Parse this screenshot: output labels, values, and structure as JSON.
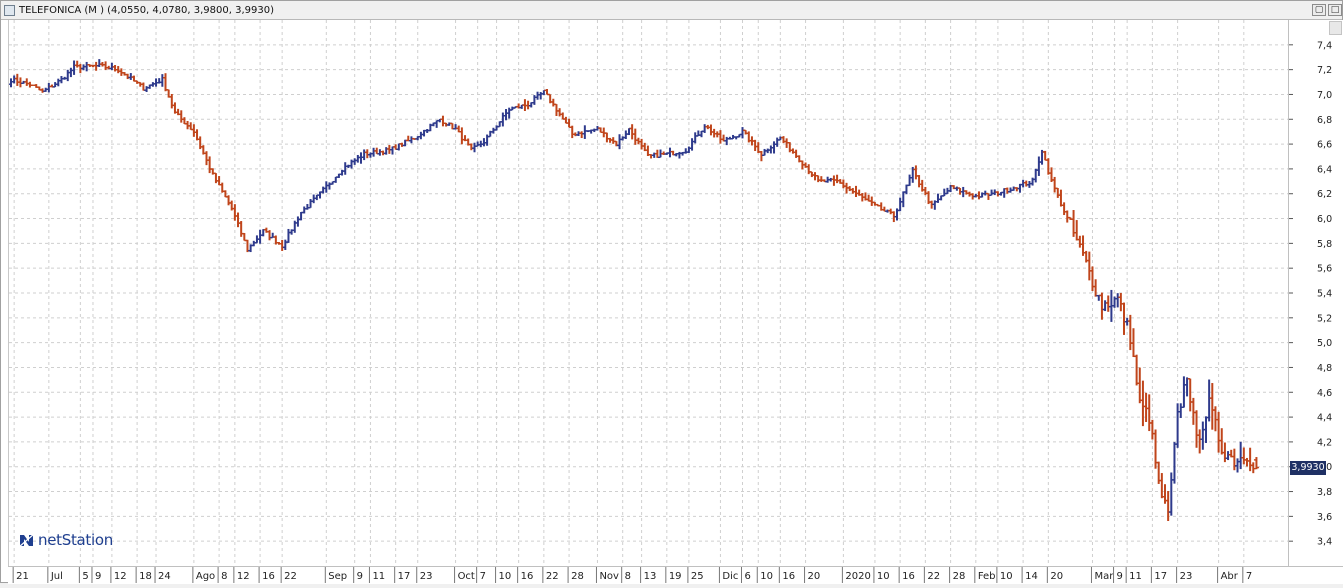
{
  "window": {
    "title": "TELEFONICA (M ) (4,0550, 4,0780, 3,9800, 3,9930)",
    "restore_glyph": "▢",
    "close_glyph": "□"
  },
  "logo": {
    "text": "netStation",
    "icon": "netstation-n-icon"
  },
  "last_price_label": "3,9930",
  "colors": {
    "up": "#2e3a8c",
    "down": "#c0451b",
    "grid": "#cfcfcf",
    "label_bg": "#1f3064"
  },
  "chart_data": {
    "type": "ohlc",
    "title": "TELEFONICA (M )",
    "last": {
      "open": 4.055,
      "high": 4.078,
      "low": 3.98,
      "close": 3.993
    },
    "ylim": [
      3.2,
      7.6
    ],
    "yticks": [
      3.4,
      3.6,
      3.8,
      4.0,
      4.2,
      4.4,
      4.6,
      4.8,
      5.0,
      5.2,
      5.4,
      5.6,
      5.8,
      6.0,
      6.2,
      6.4,
      6.6,
      6.8,
      7.0,
      7.2,
      7.4
    ],
    "ytick_labels": [
      "3,4",
      "3,6",
      "3,8",
      "4,0",
      "4,2",
      "4,4",
      "4,6",
      "4,8",
      "5,0",
      "5,2",
      "5,4",
      "5,6",
      "5,8",
      "6,0",
      "6,2",
      "6,4",
      "6,6",
      "6,8",
      "7,0",
      "7,2",
      "7,4"
    ],
    "xtick_labels": [
      {
        "i": 1,
        "label": "21"
      },
      {
        "i": 12,
        "label": "Jul"
      },
      {
        "i": 22,
        "label": "5"
      },
      {
        "i": 26,
        "label": "9"
      },
      {
        "i": 32,
        "label": "12"
      },
      {
        "i": 40,
        "label": "18"
      },
      {
        "i": 46,
        "label": "24"
      },
      {
        "i": 58,
        "label": "Ago"
      },
      {
        "i": 66,
        "label": "8"
      },
      {
        "i": 71,
        "label": "12"
      },
      {
        "i": 79,
        "label": "16"
      },
      {
        "i": 86,
        "label": "22"
      },
      {
        "i": 100,
        "label": "Sep"
      },
      {
        "i": 109,
        "label": "9"
      },
      {
        "i": 114,
        "label": "11"
      },
      {
        "i": 122,
        "label": "17"
      },
      {
        "i": 129,
        "label": "23"
      },
      {
        "i": 141,
        "label": "Oct"
      },
      {
        "i": 148,
        "label": "7"
      },
      {
        "i": 154,
        "label": "10"
      },
      {
        "i": 161,
        "label": "16"
      },
      {
        "i": 169,
        "label": "22"
      },
      {
        "i": 177,
        "label": "28"
      },
      {
        "i": 186,
        "label": "Nov"
      },
      {
        "i": 194,
        "label": "8"
      },
      {
        "i": 200,
        "label": "13"
      },
      {
        "i": 208,
        "label": "19"
      },
      {
        "i": 215,
        "label": "25"
      },
      {
        "i": 225,
        "label": "Dic"
      },
      {
        "i": 232,
        "label": "6"
      },
      {
        "i": 237,
        "label": "10"
      },
      {
        "i": 244,
        "label": "16"
      },
      {
        "i": 252,
        "label": "20"
      },
      {
        "i": 264,
        "label": "2020"
      },
      {
        "i": 274,
        "label": "10"
      },
      {
        "i": 282,
        "label": "16"
      },
      {
        "i": 290,
        "label": "22"
      },
      {
        "i": 298,
        "label": "28"
      },
      {
        "i": 306,
        "label": "Feb"
      },
      {
        "i": 313,
        "label": "10"
      },
      {
        "i": 321,
        "label": "14"
      },
      {
        "i": 329,
        "label": "20"
      },
      {
        "i": 343,
        "label": "Mar"
      },
      {
        "i": 350,
        "label": "9"
      },
      {
        "i": 354,
        "label": "11"
      },
      {
        "i": 362,
        "label": "17"
      },
      {
        "i": 370,
        "label": "23"
      },
      {
        "i": 383,
        "label": "Abr"
      },
      {
        "i": 391,
        "label": "7"
      }
    ],
    "grid": true,
    "anchors": [
      [
        0,
        7.12
      ],
      [
        6,
        7.08
      ],
      [
        10,
        7.02
      ],
      [
        16,
        7.12
      ],
      [
        20,
        7.22
      ],
      [
        28,
        7.23
      ],
      [
        34,
        7.2
      ],
      [
        42,
        7.05
      ],
      [
        48,
        7.12
      ],
      [
        52,
        6.85
      ],
      [
        58,
        6.7
      ],
      [
        64,
        6.35
      ],
      [
        70,
        6.08
      ],
      [
        75,
        5.75
      ],
      [
        80,
        5.9
      ],
      [
        86,
        5.78
      ],
      [
        92,
        6.05
      ],
      [
        98,
        6.2
      ],
      [
        105,
        6.4
      ],
      [
        112,
        6.52
      ],
      [
        120,
        6.55
      ],
      [
        128,
        6.65
      ],
      [
        136,
        6.8
      ],
      [
        141,
        6.72
      ],
      [
        146,
        6.55
      ],
      [
        150,
        6.62
      ],
      [
        158,
        6.88
      ],
      [
        164,
        6.92
      ],
      [
        169,
        7.02
      ],
      [
        173,
        6.88
      ],
      [
        178,
        6.68
      ],
      [
        186,
        6.72
      ],
      [
        192,
        6.6
      ],
      [
        196,
        6.72
      ],
      [
        202,
        6.5
      ],
      [
        208,
        6.52
      ],
      [
        214,
        6.55
      ],
      [
        220,
        6.75
      ],
      [
        226,
        6.62
      ],
      [
        232,
        6.7
      ],
      [
        238,
        6.52
      ],
      [
        244,
        6.65
      ],
      [
        250,
        6.48
      ],
      [
        256,
        6.3
      ],
      [
        262,
        6.3
      ],
      [
        268,
        6.2
      ],
      [
        274,
        6.1
      ],
      [
        280,
        6.02
      ],
      [
        286,
        6.38
      ],
      [
        292,
        6.1
      ],
      [
        298,
        6.25
      ],
      [
        306,
        6.18
      ],
      [
        312,
        6.2
      ],
      [
        318,
        6.25
      ],
      [
        324,
        6.3
      ],
      [
        327,
        6.55
      ],
      [
        330,
        6.3
      ],
      [
        335,
        6.0
      ],
      [
        340,
        5.7
      ],
      [
        346,
        5.3
      ],
      [
        351,
        5.35
      ],
      [
        355,
        5.05
      ],
      [
        358,
        4.5
      ],
      [
        361,
        4.4
      ],
      [
        364,
        3.85
      ],
      [
        367,
        3.6
      ],
      [
        370,
        4.4
      ],
      [
        373,
        4.75
      ],
      [
        376,
        4.2
      ],
      [
        380,
        4.5
      ],
      [
        384,
        4.15
      ],
      [
        388,
        4.05
      ],
      [
        392,
        4.1
      ],
      [
        395,
        4.0
      ]
    ],
    "bars": 396
  }
}
